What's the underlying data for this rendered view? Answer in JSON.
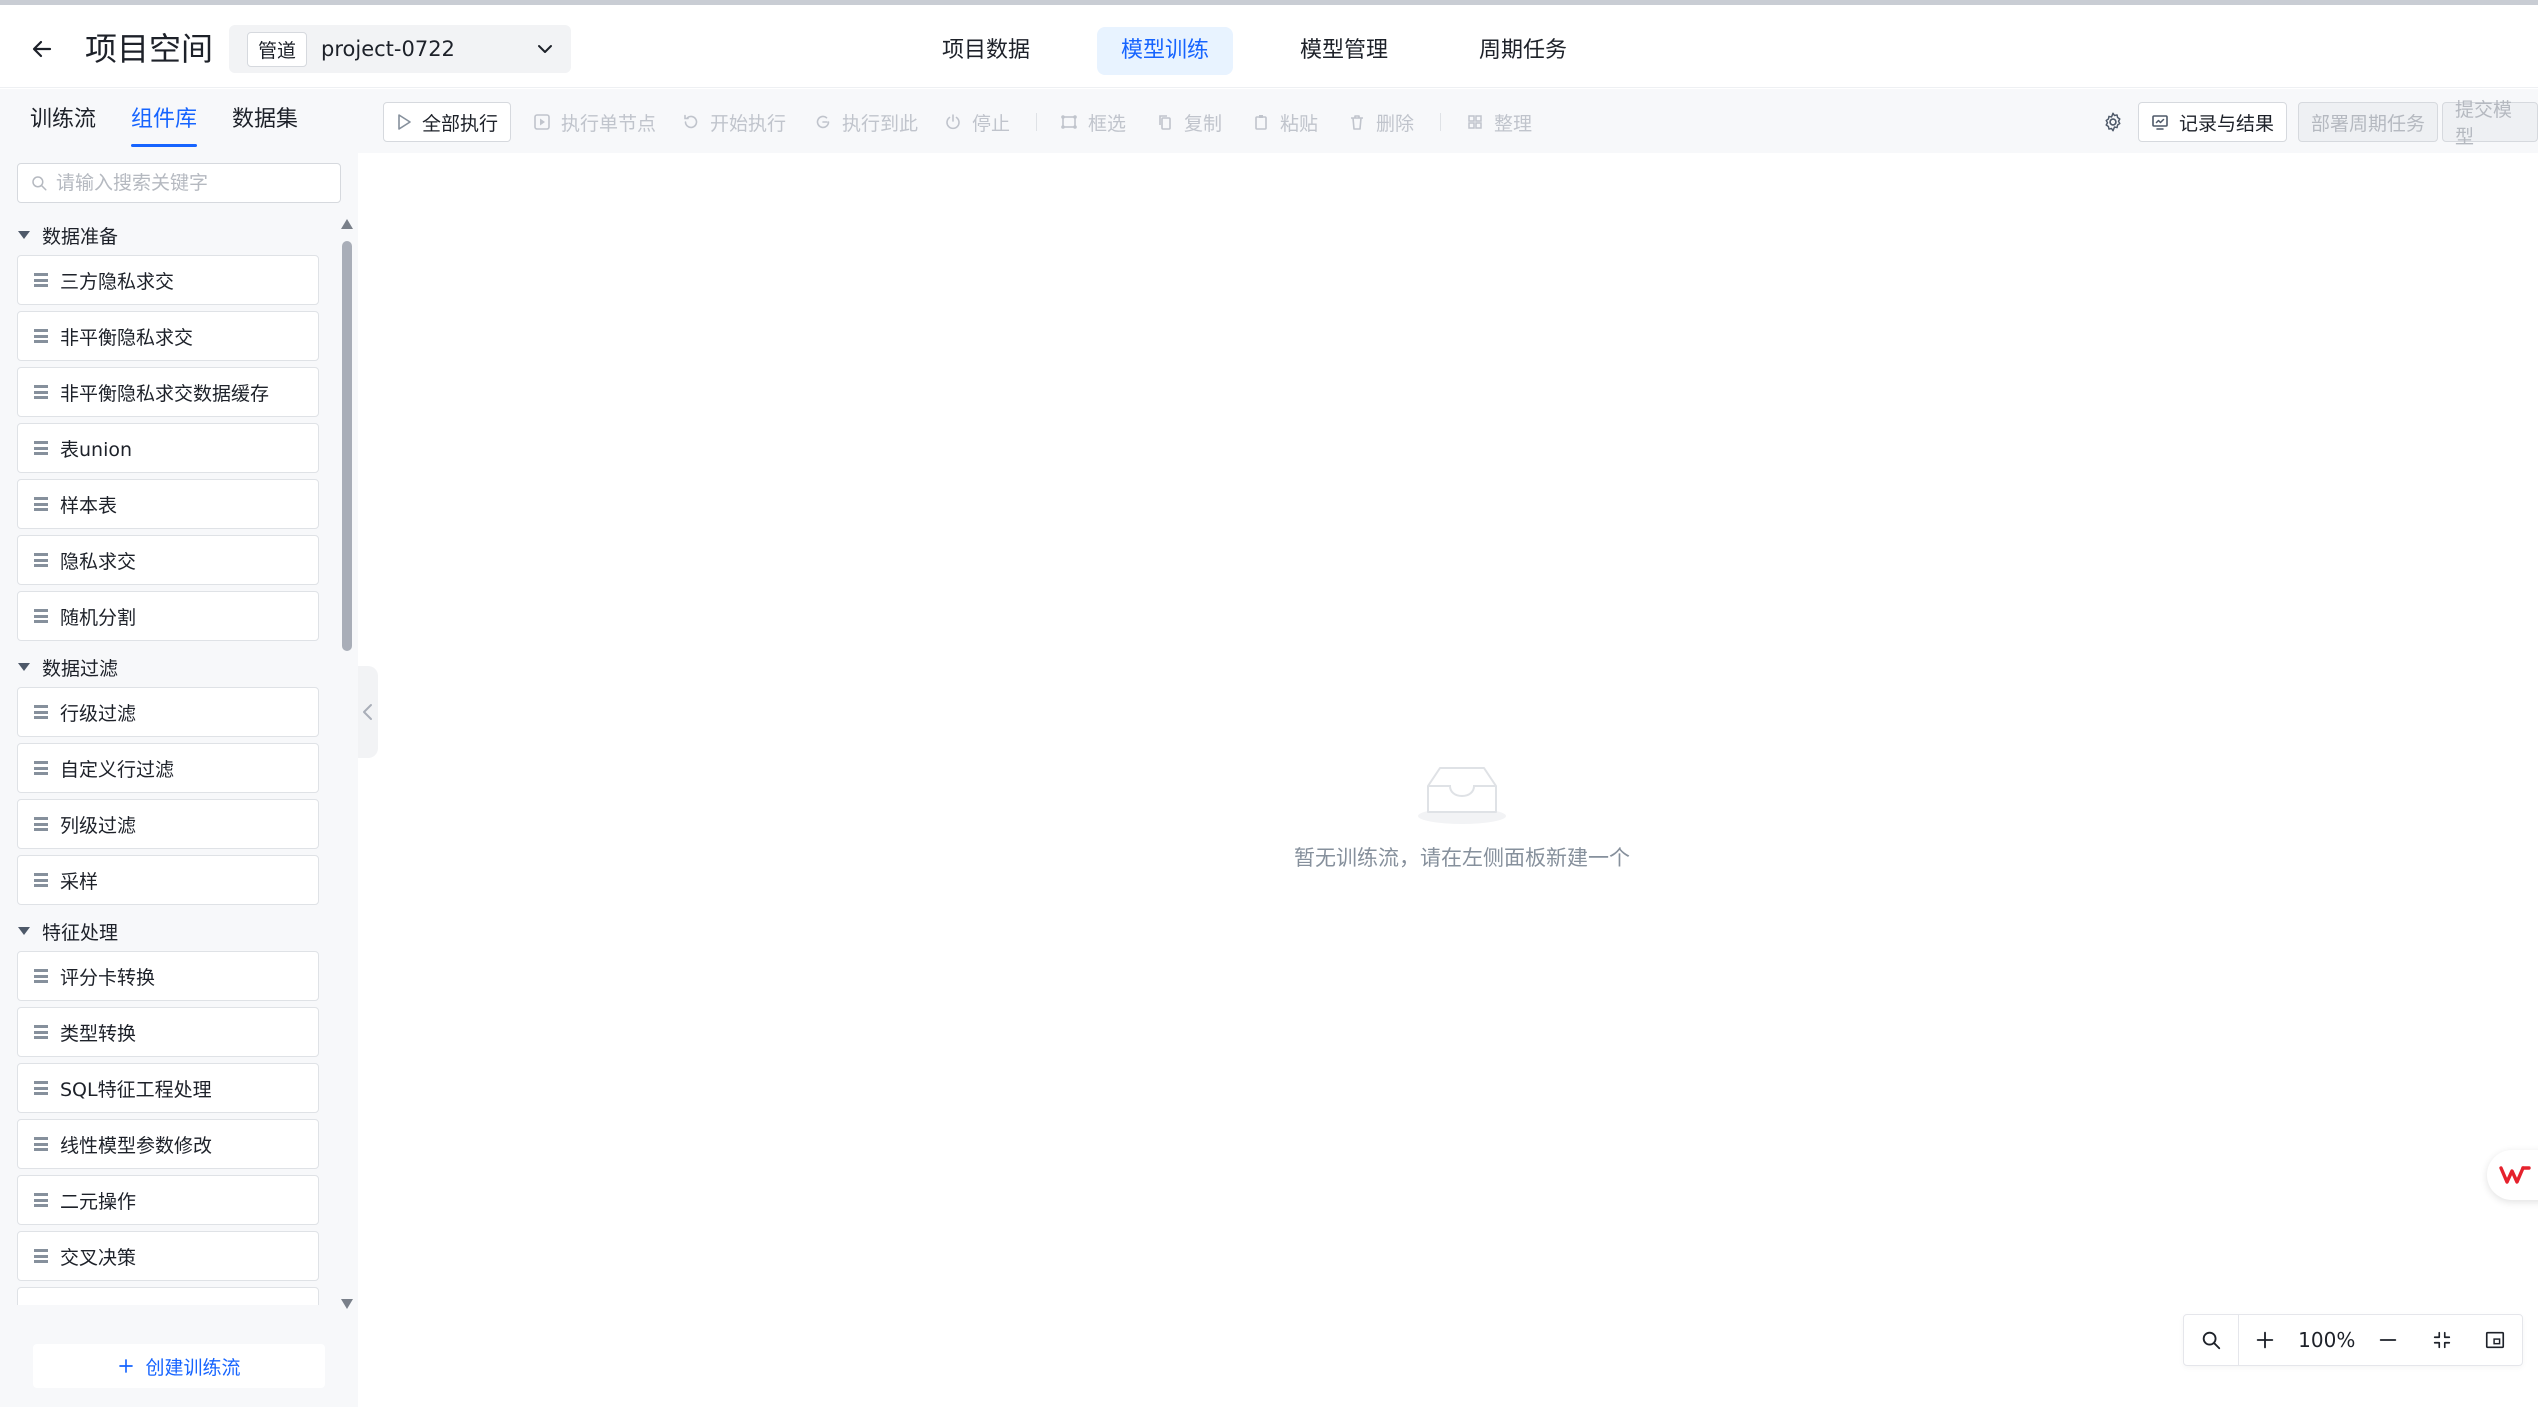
{
  "header": {
    "title": "项目空间",
    "project_tag": "管道",
    "project_name": "project-0722",
    "nav": [
      {
        "label": "项目数据",
        "active": false
      },
      {
        "label": "模型训练",
        "active": true
      },
      {
        "label": "模型管理",
        "active": false
      },
      {
        "label": "周期任务",
        "active": false
      }
    ]
  },
  "left_panel": {
    "tabs": [
      {
        "label": "训练流",
        "active": false
      },
      {
        "label": "组件库",
        "active": true
      },
      {
        "label": "数据集",
        "active": false
      }
    ],
    "search_placeholder": "请输入搜索关键字",
    "groups": [
      {
        "label": "数据准备",
        "items": [
          "三方隐私求交",
          "非平衡隐私求交",
          "非平衡隐私求交数据缓存",
          "表union",
          "样本表",
          "隐私求交",
          "随机分割"
        ]
      },
      {
        "label": "数据过滤",
        "items": [
          "行级过滤",
          "自定义行过滤",
          "列级过滤",
          "采样"
        ]
      },
      {
        "label": "特征处理",
        "items": [
          "评分卡转换",
          "类型转换",
          "SQL特征工程处理",
          "线性模型参数修改",
          "二元操作",
          "交叉决策"
        ]
      }
    ],
    "create_button": "创建训练流"
  },
  "toolbar": {
    "run_all": "全部执行",
    "run_single": "执行单节点",
    "start_run": "开始执行",
    "run_to_here": "执行到此",
    "stop": "停止",
    "box_select": "框选",
    "copy": "复制",
    "paste": "粘贴",
    "delete": "删除",
    "arrange": "整理",
    "records": "记录与结果",
    "deploy": "部署周期任务",
    "submit": "提交模型"
  },
  "canvas": {
    "empty_text": "暂无训练流，请在左侧面板新建一个"
  },
  "zoom": {
    "value": "100%"
  },
  "colors": {
    "accent": "#1664ff",
    "active_bg": "#e8f3ff",
    "panel_bg": "#f7f8fa",
    "text": "#1d2129",
    "muted": "#c0c4cc"
  }
}
